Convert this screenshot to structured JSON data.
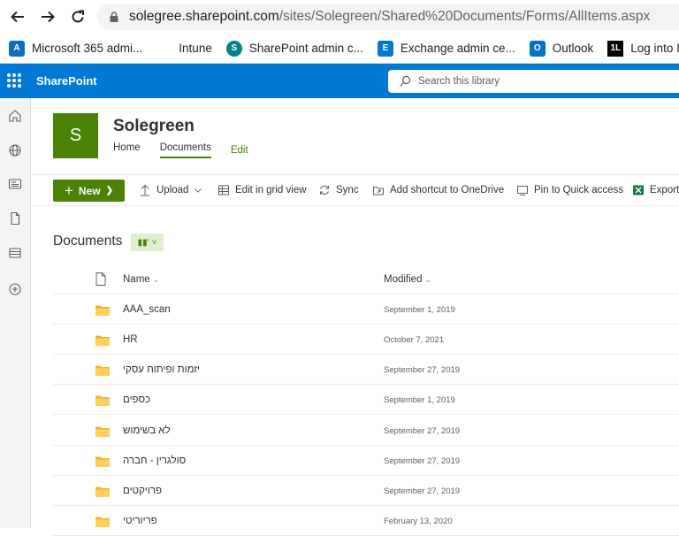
{
  "browser": {
    "url_host": "solegree.sharepoint.com",
    "url_path": "/sites/Solegreen/Shared%20Documents/Forms/AllItems.aspx",
    "bookmarks": [
      {
        "label": "Microsoft 365 admi...",
        "icon": "m365-admin-icon",
        "color": "#0f6cbd"
      },
      {
        "label": "Intune",
        "icon": "intune-icon",
        "color": "#f25022"
      },
      {
        "label": "SharePoint admin c...",
        "icon": "sharepoint-icon",
        "color": "#038387"
      },
      {
        "label": "Exchange admin ce...",
        "icon": "exchange-icon",
        "color": "#0078d4"
      },
      {
        "label": "Outlook",
        "icon": "outlook-icon",
        "color": "#0072c6"
      },
      {
        "label": "Log into Intralin",
        "icon": "intralinks-icon",
        "color": "#000000"
      }
    ]
  },
  "suitebar": {
    "brand": "SharePoint",
    "search_placeholder": "Search this library",
    "color": "#0078d4"
  },
  "site": {
    "logo_letter": "S",
    "title": "Solegreen",
    "nav": {
      "home": "Home",
      "documents": "Documents",
      "edit": "Edit"
    },
    "accent": "#498205"
  },
  "commands": {
    "new": "New",
    "upload": "Upload",
    "edit_grid": "Edit in grid view",
    "sync": "Sync",
    "add_shortcut": "Add shortcut to OneDrive",
    "pin": "Pin to Quick access",
    "export": "Export"
  },
  "library": {
    "title": "Documents",
    "columns": {
      "name": "Name",
      "modified": "Modified"
    },
    "rows": [
      {
        "name": "AAA_scan",
        "modified": "September 1, 2019"
      },
      {
        "name": "HR",
        "modified": "October 7, 2021"
      },
      {
        "name": "יזמות ופיתוח עסקי",
        "modified": "September 27, 2019"
      },
      {
        "name": "כספים",
        "modified": "September 1, 2019"
      },
      {
        "name": "לא בשימוש",
        "modified": "September 27, 2019"
      },
      {
        "name": "סולגרין - חברה",
        "modified": "September 27, 2019"
      },
      {
        "name": "פרויקטים",
        "modified": "September 27, 2019"
      },
      {
        "name": "פריוריטי",
        "modified": "February 13, 2020"
      }
    ]
  }
}
